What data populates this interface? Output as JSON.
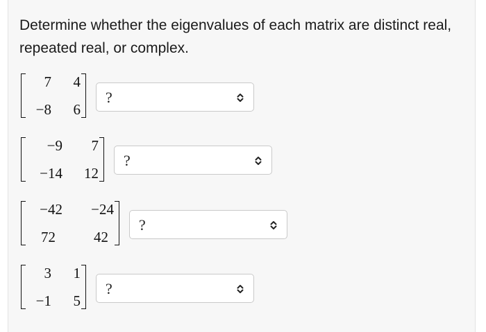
{
  "prompt": "Determine whether the eigenvalues of each matrix are distinct real, repeated real, or complex.",
  "questions": [
    {
      "matrix": [
        [
          "7",
          "4"
        ],
        [
          "−8",
          "6"
        ]
      ],
      "selected": "?"
    },
    {
      "matrix": [
        [
          "−9",
          "7"
        ],
        [
          "−14",
          "12"
        ]
      ],
      "selected": "?"
    },
    {
      "matrix": [
        [
          "−42",
          "−24"
        ],
        [
          "72",
          "42"
        ]
      ],
      "selected": "?"
    },
    {
      "matrix": [
        [
          "3",
          "1"
        ],
        [
          "−1",
          "5"
        ]
      ],
      "selected": "?"
    }
  ],
  "icons": {
    "dropdown": "chevron-up-down-icon"
  }
}
